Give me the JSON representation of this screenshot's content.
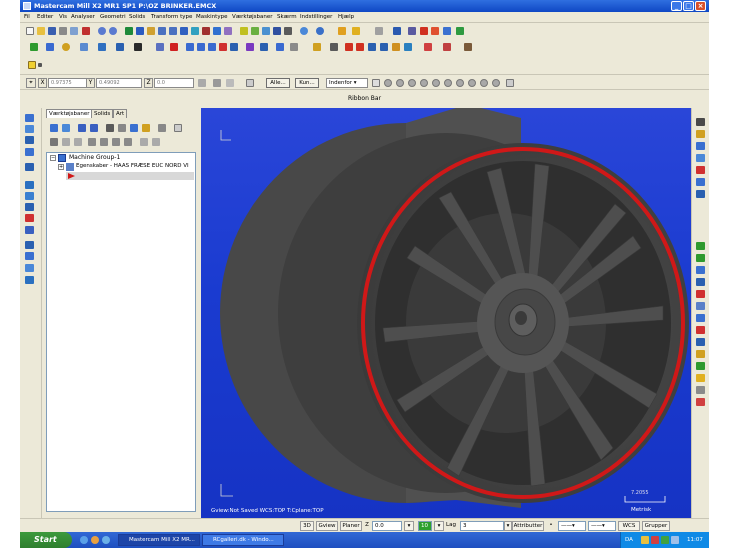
{
  "window": {
    "title": "Mastercam Mill X2 MR1 SP1 P:\\OZ BRINKER.EMCX",
    "controls": [
      "_",
      "□",
      "×"
    ]
  },
  "menubar": {
    "items": [
      "Fil",
      "Editer",
      "Vis",
      "Analyser",
      "Geometri",
      "Solids",
      "Transform type",
      "Maskintype",
      "Værktøjsbaner",
      "Skærm",
      "Indstillinger",
      "Hjælp"
    ]
  },
  "ribbon": {
    "x_label": "X",
    "x_value": "0.97375",
    "y_label": "Y",
    "y_value": "0.49092",
    "z_label": "Z",
    "z_value": "0.0",
    "btn_alle": "Alle...",
    "btn_kun": "Kun...",
    "select_mode": "Indenfor",
    "bar_label": "Ribbon Bar"
  },
  "panel": {
    "tabs": [
      "Værktøjsbaner",
      "Solids",
      "Art"
    ],
    "tree": {
      "group": "Machine Group-1",
      "item": "Egenskaber - HAAS FRÆSE EUC NORD VI"
    }
  },
  "viewport": {
    "status_text": "Gview:Not Saved  WCS:TOP  T:Cplane:TOP",
    "scale_value": "7.2055",
    "scale_unit": "Metrisk",
    "colors": {
      "background": "#1a3bd0",
      "wheel": "#4a4a4a",
      "rim_edge": "#d01818"
    }
  },
  "statusbar": {
    "btn_3d": "3D",
    "btn_gview": "Gview",
    "btn_planer": "Planer",
    "z_label": "Z",
    "z_value": "0.0",
    "color_value": "10",
    "lag_label": "Lag",
    "lag_value": "3",
    "btn_attributter": "Attributter",
    "btn_wcs": "WCS",
    "btn_grupper": "Grupper"
  },
  "taskbar": {
    "start_label": "Start",
    "tasks": [
      "Mastercam Mill X2 MR...",
      "RCgalleri.dk - Windo..."
    ],
    "lang": "DA",
    "clock": "11:07"
  }
}
